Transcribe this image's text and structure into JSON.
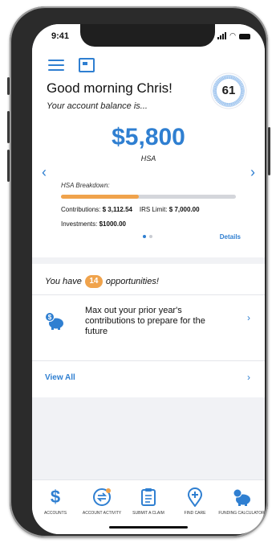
{
  "status": {
    "time": "9:41"
  },
  "header": {
    "greeting": "Good morning Chris!",
    "balance_label": "Your account balance is...",
    "score": "61",
    "balance": "$5,800",
    "account_type": "HSA",
    "breakdown_label": "HSA Breakdown:",
    "contributions_label": "Contributions:",
    "contributions_value": "$ 3,112.54",
    "irs_label": "IRS Limit:",
    "irs_value": "$ 7,000.00",
    "investments_label": "Investments:",
    "investments_value": "$1000.00",
    "contribution_progress": 0.445,
    "details_label": "Details",
    "prev_label": "‹",
    "next_label": "›",
    "page": 1,
    "pages": 2
  },
  "opportunities": {
    "prefix": "You have",
    "count": "14",
    "suffix": "opportunities!",
    "item_text": "Max out your prior year's contributions to prepare for the future",
    "item_icon": "piggy-bank-dollar-icon",
    "view_all_label": "View All"
  },
  "tabs": [
    {
      "label": "ACCOUNTS",
      "icon": "dollar-icon"
    },
    {
      "label": "ACCOUNT ACTIVITY",
      "icon": "account-activity-icon"
    },
    {
      "label": "SUBMIT A CLAIM",
      "icon": "clipboard-icon"
    },
    {
      "label": "FIND CARE",
      "icon": "location-pin-plus-icon"
    },
    {
      "label": "FUNDING CALCULATOR",
      "icon": "piggy-bank-icon"
    }
  ],
  "colors": {
    "accent": "#2f7fd1",
    "orange": "#f0a34c",
    "background": "#f1f2f5"
  }
}
